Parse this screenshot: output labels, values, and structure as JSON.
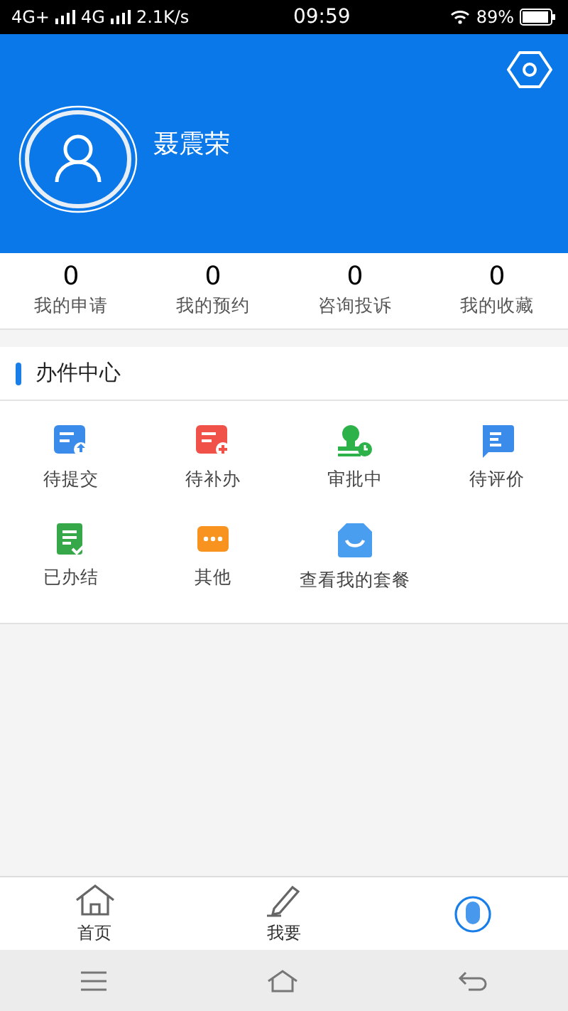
{
  "status_bar": {
    "network_1": "4G+",
    "network_2": "4G",
    "speed": "2.1K/s",
    "time": "09:59",
    "battery": "89%"
  },
  "profile": {
    "name": "聂震荣"
  },
  "stats": [
    {
      "count": "0",
      "label": "我的申请"
    },
    {
      "count": "0",
      "label": "我的预约"
    },
    {
      "count": "0",
      "label": "咨询投诉"
    },
    {
      "count": "0",
      "label": "我的收藏"
    }
  ],
  "section": {
    "title": "办件中心",
    "items": [
      {
        "kind": "submit",
        "label": "待提交"
      },
      {
        "kind": "supplement",
        "label": "待补办"
      },
      {
        "kind": "approving",
        "label": "审批中"
      },
      {
        "kind": "review",
        "label": "待评价"
      },
      {
        "kind": "done",
        "label": "已办结"
      },
      {
        "kind": "other",
        "label": "其他"
      },
      {
        "kind": "package",
        "label": "查看我的套餐"
      }
    ]
  },
  "tab_bar": [
    {
      "kind": "home",
      "label": "首页",
      "selected": false
    },
    {
      "kind": "apply",
      "label": "我要",
      "selected": false
    },
    {
      "kind": "me",
      "selected": true
    }
  ]
}
